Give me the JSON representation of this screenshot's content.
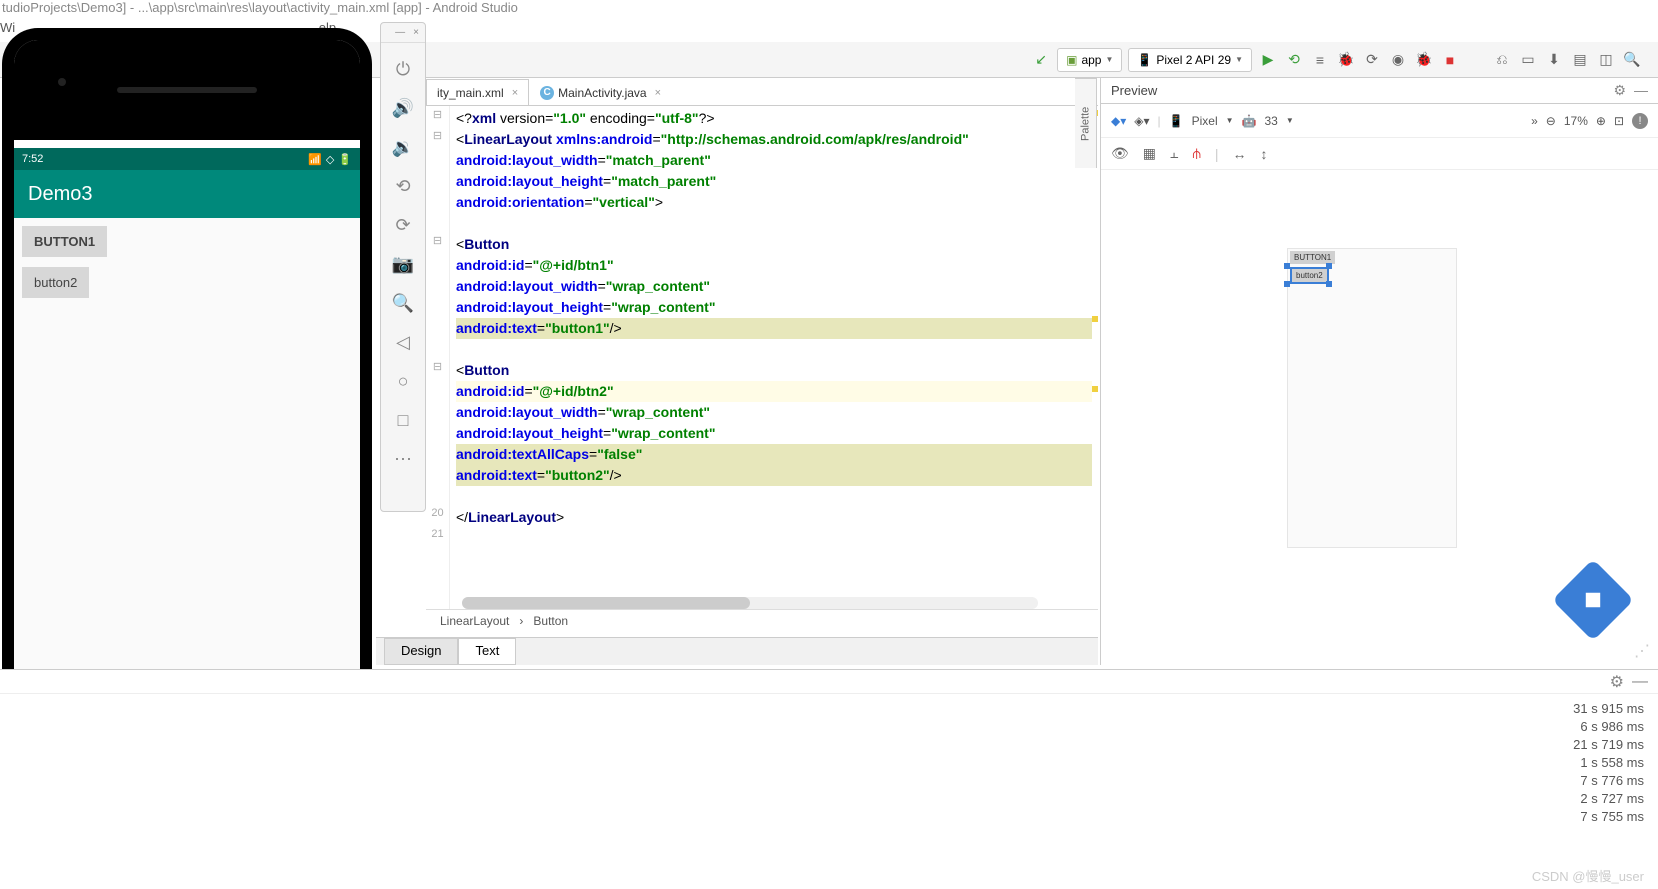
{
  "window": {
    "title": "tudioProjects\\Demo3] - ...\\app\\src\\main\\res\\layout\\activity_main.xml [app] - Android Studio",
    "menu_partial1": "Wi",
    "menu_partial2": "elp"
  },
  "toolbar": {
    "run_config": "app",
    "device": "Pixel 2 API 29"
  },
  "tabs": {
    "xml_tab": "ity_main.xml",
    "java_tab": "MainActivity.java"
  },
  "emulator": {
    "status_time": "7:52",
    "app_title": "Demo3",
    "button1": "BUTTON1",
    "button2": "button2"
  },
  "code": {
    "lines": [
      {
        "t": "<?xml version=\"1.0\" encoding=\"utf-8\"?>",
        "cls": ""
      },
      {
        "t": "<LinearLayout xmlns:android=\"http://schemas.android.com/apk/res/android\"",
        "cls": ""
      },
      {
        "t": "    android:layout_width=\"match_parent\"",
        "cls": ""
      },
      {
        "t": "    android:layout_height=\"match_parent\"",
        "cls": ""
      },
      {
        "t": "    android:orientation=\"vertical\">",
        "cls": ""
      },
      {
        "t": "",
        "cls": ""
      },
      {
        "t": "    <Button",
        "cls": ""
      },
      {
        "t": "        android:id=\"@+id/btn1\"",
        "cls": ""
      },
      {
        "t": "        android:layout_width=\"wrap_content\"",
        "cls": ""
      },
      {
        "t": "        android:layout_height=\"wrap_content\"",
        "cls": ""
      },
      {
        "t": "        android:text=\"button1\"/>",
        "cls": "hl-attr"
      },
      {
        "t": "",
        "cls": ""
      },
      {
        "t": "    <Button",
        "cls": ""
      },
      {
        "t": "        android:id=\"@+id/btn2\"",
        "cls": "hl-line"
      },
      {
        "t": "        android:layout_width=\"wrap_content\"",
        "cls": ""
      },
      {
        "t": "        android:layout_height=\"wrap_content\"",
        "cls": ""
      },
      {
        "t": "        android:textAllCaps=\"false\"",
        "cls": "hl-attr"
      },
      {
        "t": "        android:text=\"button2\"/>",
        "cls": "hl-attr"
      },
      {
        "t": "",
        "cls": ""
      },
      {
        "t": "</LinearLayout>",
        "cls": ""
      }
    ],
    "visible_end_lines": [
      "20",
      "21"
    ]
  },
  "breadcrumb": {
    "l1": "LinearLayout",
    "sep": "›",
    "l2": "Button"
  },
  "footer_tabs": {
    "design": "Design",
    "text": "Text"
  },
  "preview": {
    "title": "Preview",
    "device": "Pixel",
    "api": "33",
    "zoom": "17%",
    "palette_label": "Palette",
    "btn1": "BUTTON1",
    "btn2": "button2"
  },
  "log": {
    "lines": [
      "31 s 915 ms",
      "6 s 986 ms",
      "21 s 719 ms",
      "1 s 558 ms",
      "7 s 776 ms",
      "2 s 727 ms",
      "7 s 755 ms"
    ]
  },
  "watermark": "CSDN @慢慢_user"
}
